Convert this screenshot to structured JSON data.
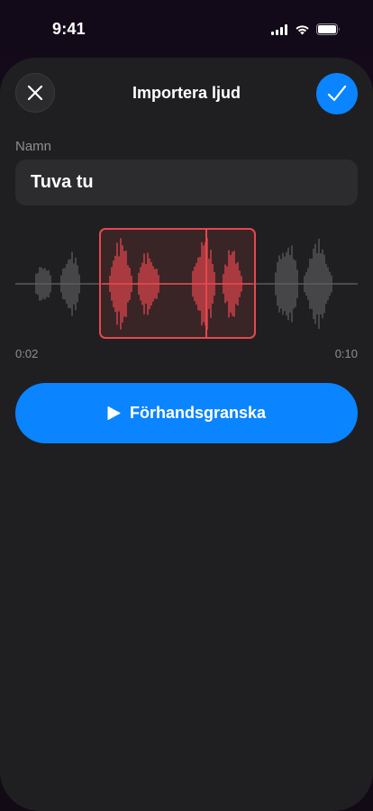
{
  "status_bar": {
    "time": "9:41",
    "icons": [
      "signal-icon",
      "wifi-icon",
      "battery-icon"
    ]
  },
  "header": {
    "title": "Importera ljud",
    "close_icon": "close-icon",
    "confirm_icon": "checkmark-icon"
  },
  "name_field": {
    "label": "Namn",
    "value": "Tuva tu"
  },
  "trimmer": {
    "start_time": "0:02",
    "end_time": "0:10"
  },
  "preview": {
    "label": "Förhandsgranska",
    "icon": "play-icon"
  },
  "colors": {
    "accent": "#0a84ff",
    "selection": "#e5484d",
    "waveform_inactive": "#5c5c5f",
    "sheet_background": "#1f1f21"
  }
}
